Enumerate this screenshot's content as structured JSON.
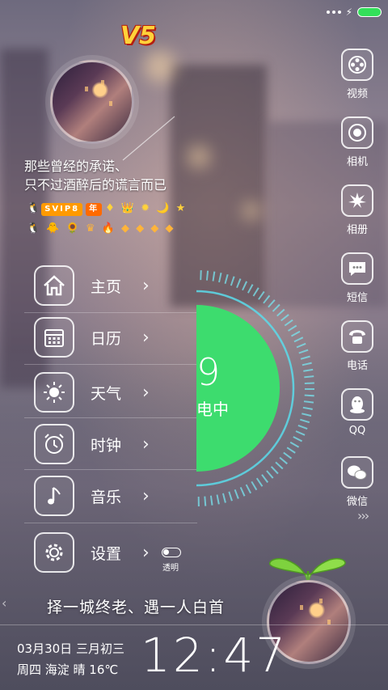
{
  "status": {
    "battery_color": "#33e05a"
  },
  "badge": {
    "text": "V5"
  },
  "motto": {
    "line1": "那些曾经的承诺、",
    "line2": "只不过酒醉后的谎言而已"
  },
  "badges": {
    "vip": "SVIP8",
    "year": "年",
    "row1": "♦ 👑 ✹ 🌙 ★",
    "row2": "🐧 🐥 🌻 ♛ 🔥 ◆ ◆ ◆ ◆"
  },
  "menu": {
    "items": [
      {
        "label": "主页",
        "icon": "home-icon"
      },
      {
        "label": "日历",
        "icon": "calendar-icon"
      },
      {
        "label": "天气",
        "icon": "sun-icon"
      },
      {
        "label": "时钟",
        "icon": "alarm-clock-icon"
      },
      {
        "label": "音乐",
        "icon": "music-note-icon"
      },
      {
        "label": "设置",
        "icon": "gear-icon"
      }
    ],
    "toggle_label": "透明"
  },
  "ring": {
    "number": "9",
    "text": "电中",
    "color": "#3ddc6e"
  },
  "dock": {
    "items": [
      {
        "label": "视频",
        "icon": "video-reel-icon"
      },
      {
        "label": "相机",
        "icon": "camera-lens-icon"
      },
      {
        "label": "相册",
        "icon": "leaf-gallery-icon"
      },
      {
        "label": "短信",
        "icon": "chat-bubble-icon"
      },
      {
        "label": "电话",
        "icon": "phone-icon"
      },
      {
        "label": "QQ",
        "icon": "qq-penguin-icon"
      },
      {
        "label": "微信",
        "icon": "wechat-icon"
      }
    ]
  },
  "slogan": "择一城终老、遇一人白首",
  "date": {
    "line1": "03月30日 三月初三",
    "line2": "周四 海淀 晴 16℃"
  },
  "clock": "12:47"
}
